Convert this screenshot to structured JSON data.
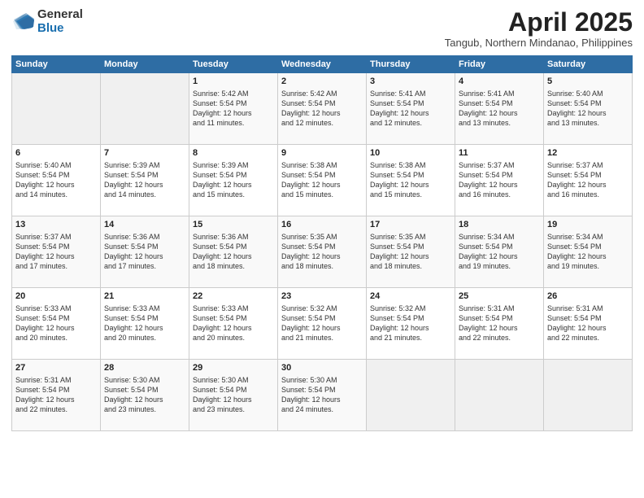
{
  "logo": {
    "general": "General",
    "blue": "Blue"
  },
  "title": {
    "month_year": "April 2025",
    "location": "Tangub, Northern Mindanao, Philippines"
  },
  "headers": [
    "Sunday",
    "Monday",
    "Tuesday",
    "Wednesday",
    "Thursday",
    "Friday",
    "Saturday"
  ],
  "weeks": [
    [
      {
        "num": "",
        "info": ""
      },
      {
        "num": "",
        "info": ""
      },
      {
        "num": "1",
        "info": "Sunrise: 5:42 AM\nSunset: 5:54 PM\nDaylight: 12 hours\nand 11 minutes."
      },
      {
        "num": "2",
        "info": "Sunrise: 5:42 AM\nSunset: 5:54 PM\nDaylight: 12 hours\nand 12 minutes."
      },
      {
        "num": "3",
        "info": "Sunrise: 5:41 AM\nSunset: 5:54 PM\nDaylight: 12 hours\nand 12 minutes."
      },
      {
        "num": "4",
        "info": "Sunrise: 5:41 AM\nSunset: 5:54 PM\nDaylight: 12 hours\nand 13 minutes."
      },
      {
        "num": "5",
        "info": "Sunrise: 5:40 AM\nSunset: 5:54 PM\nDaylight: 12 hours\nand 13 minutes."
      }
    ],
    [
      {
        "num": "6",
        "info": "Sunrise: 5:40 AM\nSunset: 5:54 PM\nDaylight: 12 hours\nand 14 minutes."
      },
      {
        "num": "7",
        "info": "Sunrise: 5:39 AM\nSunset: 5:54 PM\nDaylight: 12 hours\nand 14 minutes."
      },
      {
        "num": "8",
        "info": "Sunrise: 5:39 AM\nSunset: 5:54 PM\nDaylight: 12 hours\nand 15 minutes."
      },
      {
        "num": "9",
        "info": "Sunrise: 5:38 AM\nSunset: 5:54 PM\nDaylight: 12 hours\nand 15 minutes."
      },
      {
        "num": "10",
        "info": "Sunrise: 5:38 AM\nSunset: 5:54 PM\nDaylight: 12 hours\nand 15 minutes."
      },
      {
        "num": "11",
        "info": "Sunrise: 5:37 AM\nSunset: 5:54 PM\nDaylight: 12 hours\nand 16 minutes."
      },
      {
        "num": "12",
        "info": "Sunrise: 5:37 AM\nSunset: 5:54 PM\nDaylight: 12 hours\nand 16 minutes."
      }
    ],
    [
      {
        "num": "13",
        "info": "Sunrise: 5:37 AM\nSunset: 5:54 PM\nDaylight: 12 hours\nand 17 minutes."
      },
      {
        "num": "14",
        "info": "Sunrise: 5:36 AM\nSunset: 5:54 PM\nDaylight: 12 hours\nand 17 minutes."
      },
      {
        "num": "15",
        "info": "Sunrise: 5:36 AM\nSunset: 5:54 PM\nDaylight: 12 hours\nand 18 minutes."
      },
      {
        "num": "16",
        "info": "Sunrise: 5:35 AM\nSunset: 5:54 PM\nDaylight: 12 hours\nand 18 minutes."
      },
      {
        "num": "17",
        "info": "Sunrise: 5:35 AM\nSunset: 5:54 PM\nDaylight: 12 hours\nand 18 minutes."
      },
      {
        "num": "18",
        "info": "Sunrise: 5:34 AM\nSunset: 5:54 PM\nDaylight: 12 hours\nand 19 minutes."
      },
      {
        "num": "19",
        "info": "Sunrise: 5:34 AM\nSunset: 5:54 PM\nDaylight: 12 hours\nand 19 minutes."
      }
    ],
    [
      {
        "num": "20",
        "info": "Sunrise: 5:33 AM\nSunset: 5:54 PM\nDaylight: 12 hours\nand 20 minutes."
      },
      {
        "num": "21",
        "info": "Sunrise: 5:33 AM\nSunset: 5:54 PM\nDaylight: 12 hours\nand 20 minutes."
      },
      {
        "num": "22",
        "info": "Sunrise: 5:33 AM\nSunset: 5:54 PM\nDaylight: 12 hours\nand 20 minutes."
      },
      {
        "num": "23",
        "info": "Sunrise: 5:32 AM\nSunset: 5:54 PM\nDaylight: 12 hours\nand 21 minutes."
      },
      {
        "num": "24",
        "info": "Sunrise: 5:32 AM\nSunset: 5:54 PM\nDaylight: 12 hours\nand 21 minutes."
      },
      {
        "num": "25",
        "info": "Sunrise: 5:31 AM\nSunset: 5:54 PM\nDaylight: 12 hours\nand 22 minutes."
      },
      {
        "num": "26",
        "info": "Sunrise: 5:31 AM\nSunset: 5:54 PM\nDaylight: 12 hours\nand 22 minutes."
      }
    ],
    [
      {
        "num": "27",
        "info": "Sunrise: 5:31 AM\nSunset: 5:54 PM\nDaylight: 12 hours\nand 22 minutes."
      },
      {
        "num": "28",
        "info": "Sunrise: 5:30 AM\nSunset: 5:54 PM\nDaylight: 12 hours\nand 23 minutes."
      },
      {
        "num": "29",
        "info": "Sunrise: 5:30 AM\nSunset: 5:54 PM\nDaylight: 12 hours\nand 23 minutes."
      },
      {
        "num": "30",
        "info": "Sunrise: 5:30 AM\nSunset: 5:54 PM\nDaylight: 12 hours\nand 24 minutes."
      },
      {
        "num": "",
        "info": ""
      },
      {
        "num": "",
        "info": ""
      },
      {
        "num": "",
        "info": ""
      }
    ]
  ]
}
